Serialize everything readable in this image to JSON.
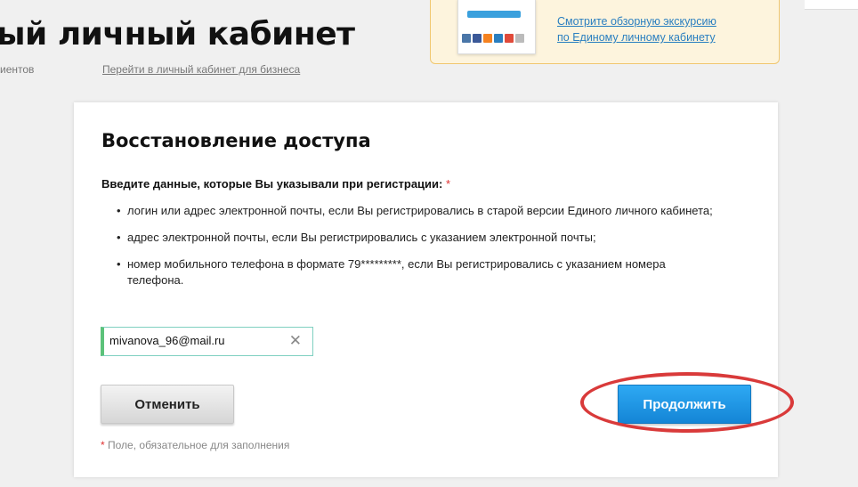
{
  "header": {
    "title": "ый личный кабинет",
    "subtitle_left": "иентов",
    "business_link": "Перейти в личный кабинет для бизнеса"
  },
  "tour": {
    "link_line1": "Смотрите обзорную экскурсию",
    "link_line2": "по Единому личному кабинету"
  },
  "form": {
    "title": "Восстановление доступа",
    "instruction": "Введите данные, которые Вы указывали при регистрации:",
    "required_mark": "*",
    "bullets": [
      "логин или адрес электронной почты, если Вы регистрировались в старой версии Единого личного кабинета;",
      "адрес электронной почты, если Вы регистрировались с указанием электронной почты;",
      "номер мобильного телефона в формате 79*********, если Вы регистрировались с указанием номера телефона."
    ],
    "bullet_symbol": "•",
    "email_value": "mivanova_96@mail.ru",
    "clear_symbol": "✕",
    "cancel_label": "Отменить",
    "continue_label": "Продолжить",
    "required_note": "Поле, обязательное для заполнения"
  },
  "colors": {
    "primary_button": "#1e96e6",
    "highlight_ring": "#d93a3a",
    "tour_background": "#fdf4dd",
    "field_accent": "#5cc27a"
  }
}
